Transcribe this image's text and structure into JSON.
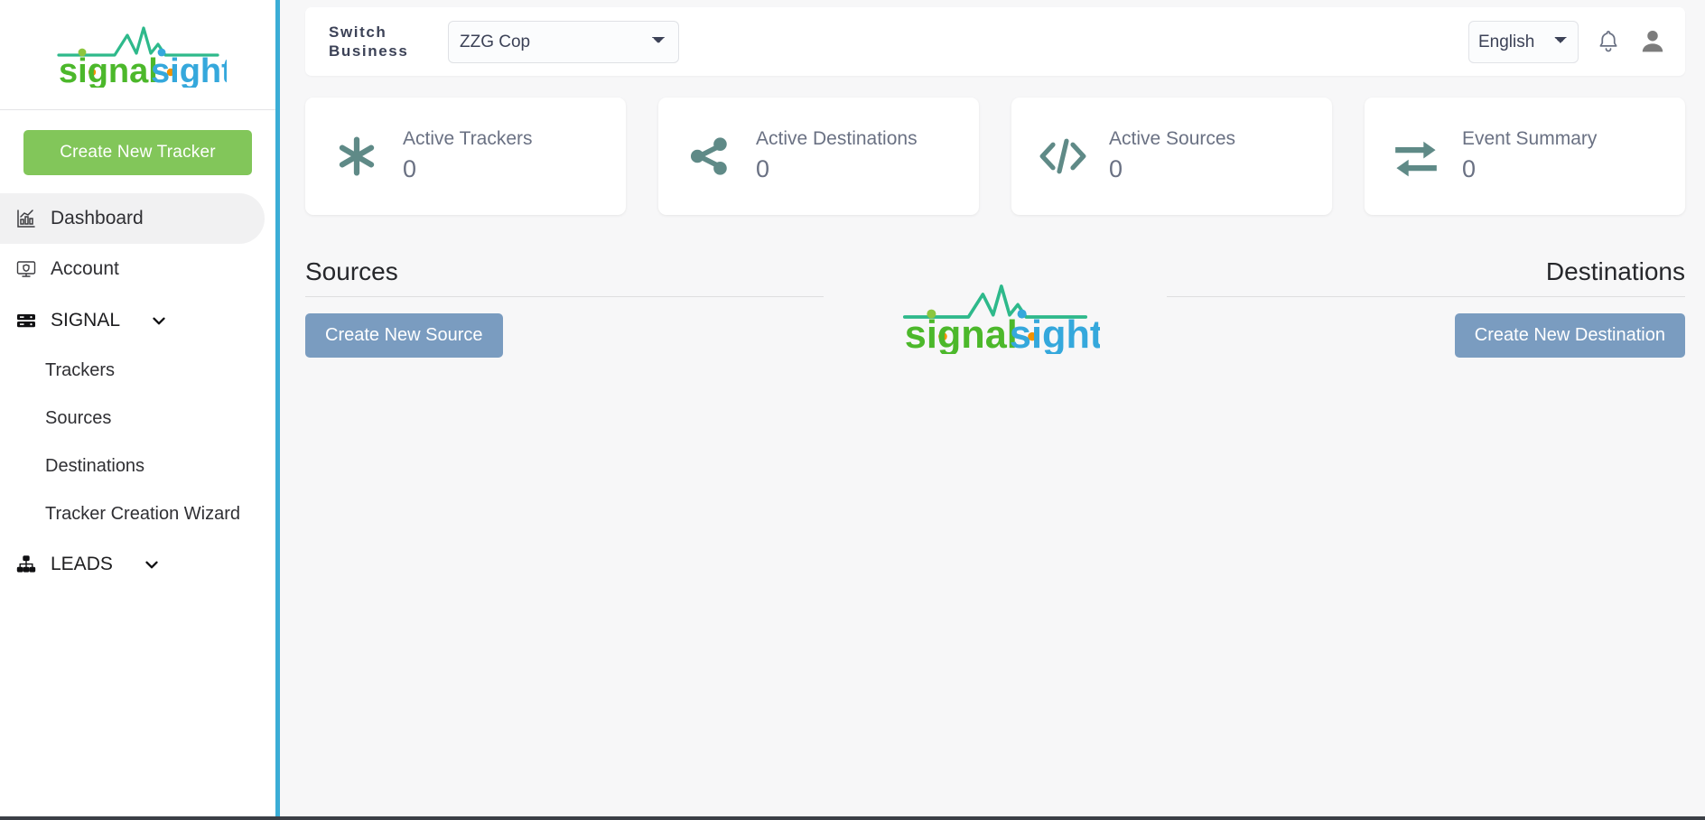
{
  "brand": {
    "name_part1": "signal",
    "name_part2": "sight",
    "green": "#4CB82B",
    "blue": "#35A8DC",
    "wave_teal": "#2EB98B",
    "dot_orange": "#F39200",
    "dot_green": "#8CC63F"
  },
  "sidebar": {
    "create_tracker_label": "Create New Tracker",
    "create_tracker_color": "#82c65a",
    "accent_border": "#3badd6",
    "items": [
      {
        "label": "Dashboard",
        "icon": "bar-chart-icon",
        "active": true
      },
      {
        "label": "Account",
        "icon": "monitor-shield-icon",
        "active": false
      }
    ],
    "groups": [
      {
        "label": "SIGNAL",
        "icon": "server-stack-icon",
        "expanded": true,
        "children": [
          {
            "label": "Trackers"
          },
          {
            "label": "Sources"
          },
          {
            "label": "Destinations"
          },
          {
            "label": "Tracker Creation Wizard"
          }
        ]
      },
      {
        "label": "LEADS",
        "icon": "sitemap-icon",
        "expanded": false,
        "children": []
      }
    ]
  },
  "topbar": {
    "switch_business_label": "Switch Business",
    "business_selected": "ZZG Cop",
    "business_options": [
      "ZZG Cop"
    ],
    "language_selected": "English",
    "language_options": [
      "English"
    ],
    "notification_icon": "bell-icon",
    "avatar_icon": "user-avatar-icon"
  },
  "cards": [
    {
      "title": "Active Trackers",
      "value": "0",
      "icon": "asterisk-icon"
    },
    {
      "title": "Active Destinations",
      "value": "0",
      "icon": "share-network-icon"
    },
    {
      "title": "Active Sources",
      "value": "0",
      "icon": "code-brackets-icon"
    },
    {
      "title": "Event Summary",
      "value": "0",
      "icon": "exchange-arrows-icon"
    }
  ],
  "sections": {
    "sources": {
      "heading": "Sources",
      "button_label": "Create New Source"
    },
    "destinations": {
      "heading": "Destinations",
      "button_label": "Create New Destination"
    },
    "button_color": "#7a9cc0"
  }
}
